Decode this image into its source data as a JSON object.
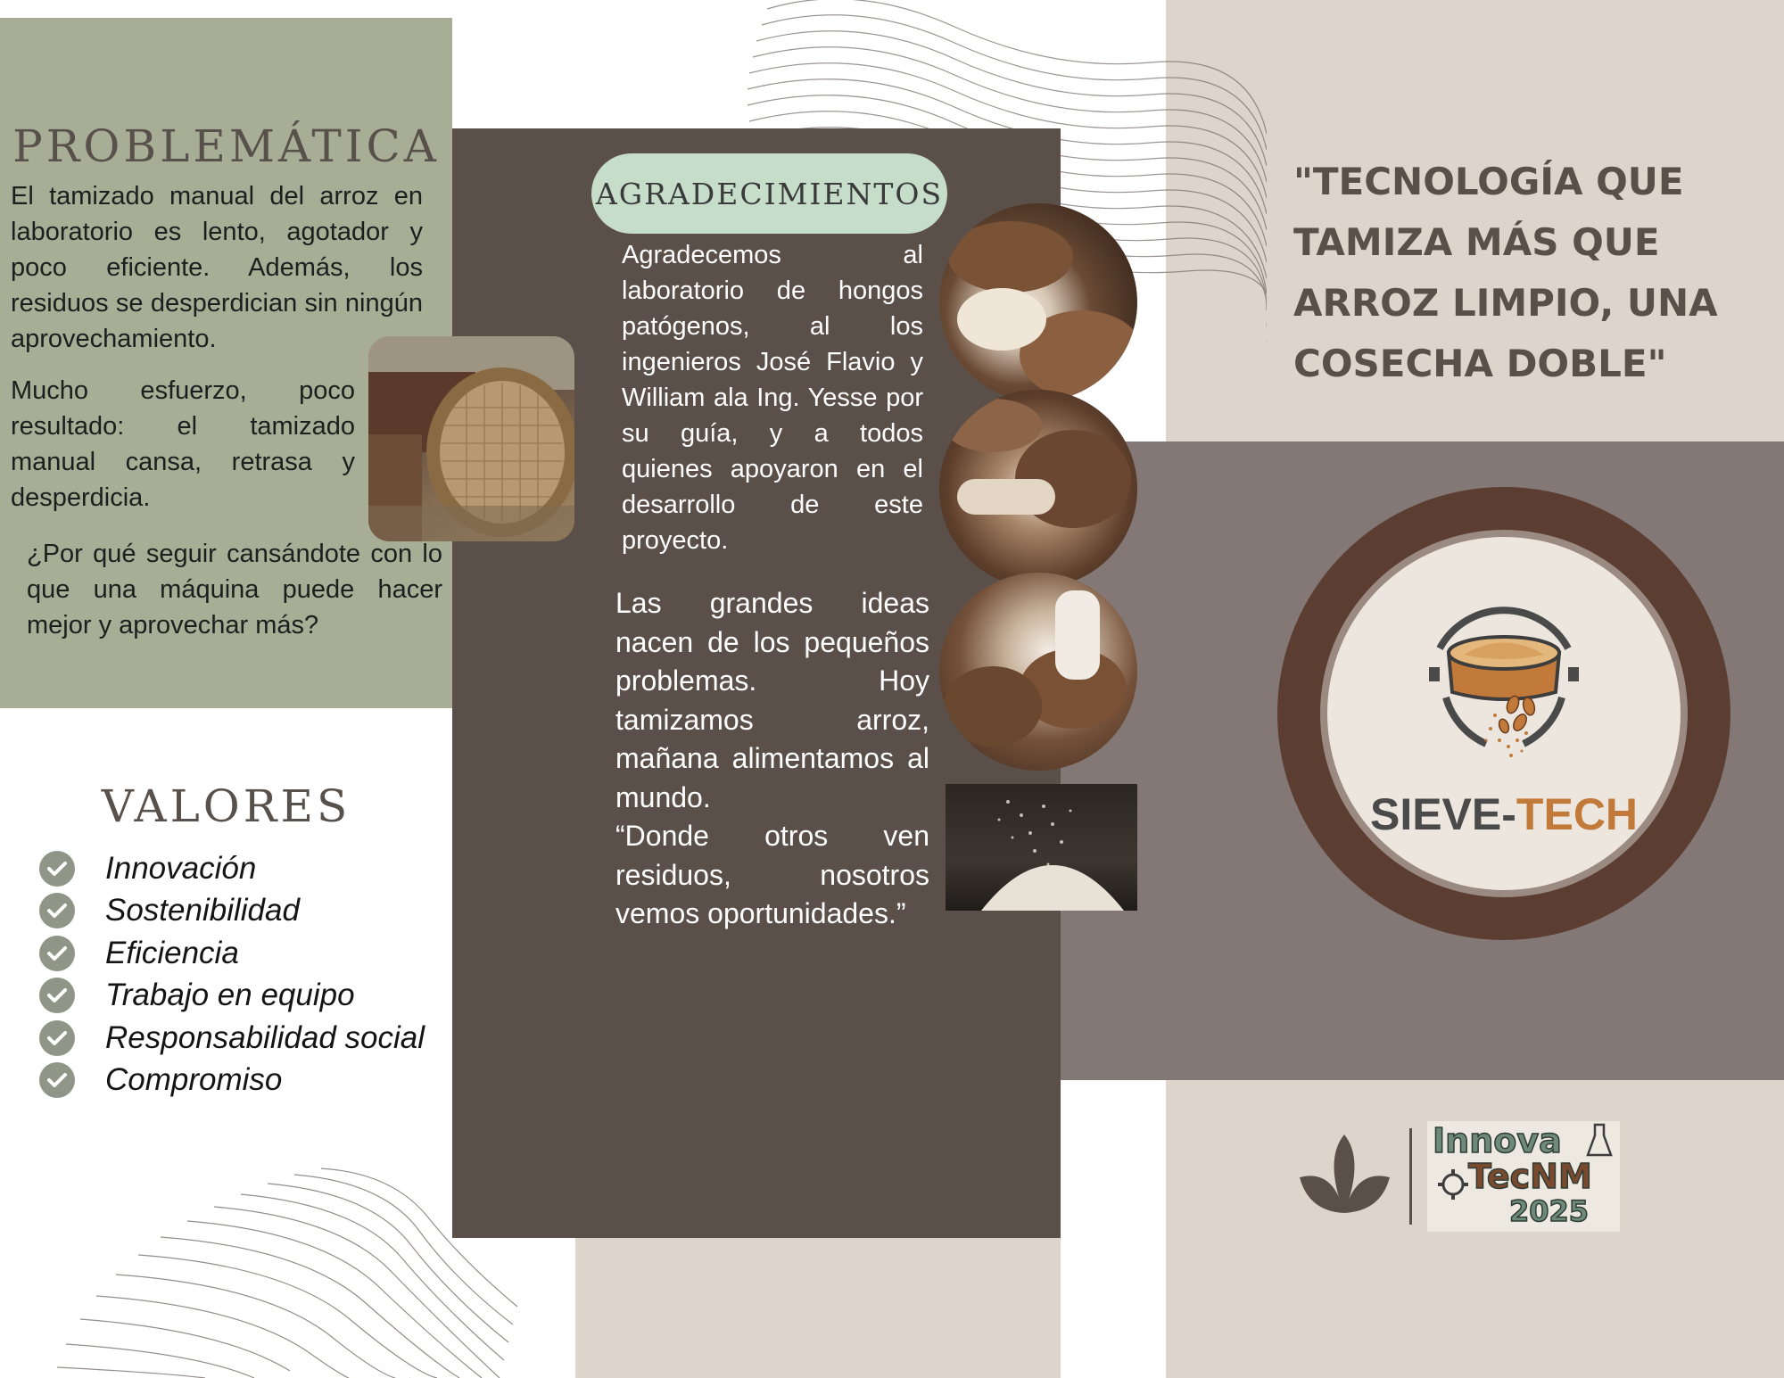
{
  "problematica": {
    "title": "PROBLEMÁTICA",
    "paragraph1": "El tamizado manual del arroz en laboratorio es lento, agotador y poco eficiente. Además, los residuos se desperdician sin ningún aprovechamiento.",
    "paragraph2": "Mucho esfuerzo, poco resultado: el tamizado manual cansa, retrasa y desperdicia.",
    "paragraph3": "¿Por qué seguir cansándote con lo que una máquina puede hacer mejor y aprovechar más?"
  },
  "valores": {
    "title": "VALORES",
    "items": [
      "Innovación",
      "Sostenibilidad",
      "Eficiencia",
      "Trabajo en equipo",
      "Responsabilidad social",
      "Compromiso"
    ]
  },
  "agradecimientos": {
    "title": "AGRADECIMIENTOS",
    "text": "Agradecemos al laboratorio de hongos patógenos, al los ingenieros José Flavio y William ala Ing. Yesse por su guía, y a todos quienes apoyaron en el desarrollo de este proyecto.",
    "quote_line1": "Las grandes ideas nacen de los pequeños problemas. Hoy tamizamos arroz, mañana alimentamos al mundo.",
    "quote_line2": "“Donde otros ven residuos, nosotros vemos oportunidades.”"
  },
  "tagline": "\"TECNOLOGÍA QUE TAMIZA MÁS QUE ARROZ LIMPIO, UNA COSECHA DOBLE\"",
  "brand": {
    "name_part1": "SIEVE-",
    "name_part2": "TECH"
  },
  "sponsor_logo": {
    "line1": "Innova",
    "line2": "TecNM",
    "line3": "2025"
  },
  "icons": [
    "check-icon",
    "leaf-icon",
    "sieve-icon"
  ],
  "colors": {
    "sage": "#a8ad96",
    "dark_brown": "#5b4f49",
    "taupe": "#837875",
    "beige": "#ddd4cb",
    "mint": "#c6ddca",
    "logo_ring": "#5c3d31",
    "logo_inner": "#ede6df",
    "accent_orange": "#c27a3a"
  }
}
